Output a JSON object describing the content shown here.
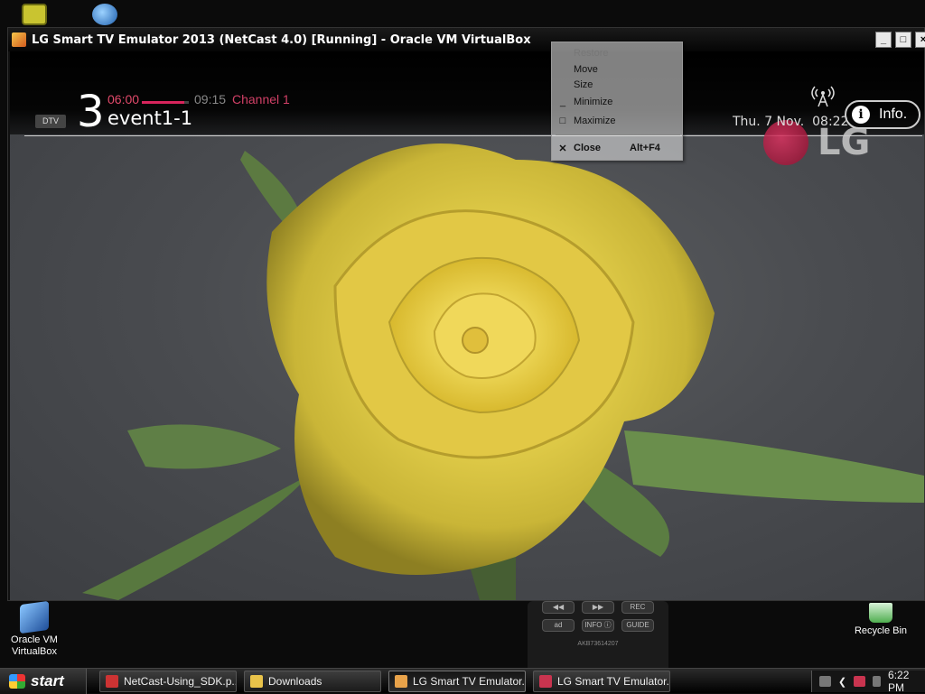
{
  "window": {
    "title": "LG Smart TV Emulator 2013 (NetCast 4.0) [Running] - Oracle VM VirtualBox",
    "minimize_label": "_",
    "maximize_label": "□",
    "close_label": "×"
  },
  "tv": {
    "badge": "DTV",
    "channel_number": "3",
    "start_time": "06:00",
    "end_time": "09:15",
    "channel_name": "Channel 1",
    "event_name": "event1-1",
    "progress": 0.9,
    "date": "Thu. 7 Nov.  08:22",
    "info_label": "Info.",
    "info_glyph": "i",
    "logo_text": "LG"
  },
  "context_menu": {
    "items": [
      {
        "label": "Restore",
        "marker": "",
        "accel": "",
        "enabled": false
      },
      {
        "label": "Move",
        "marker": "",
        "accel": "",
        "enabled": true
      },
      {
        "label": "Size",
        "marker": "",
        "accel": "",
        "enabled": true
      },
      {
        "label": "Minimize",
        "marker": "_",
        "accel": "",
        "enabled": true
      },
      {
        "label": "Maximize",
        "marker": "□",
        "accel": "",
        "enabled": true
      },
      {
        "label": "Close",
        "marker": "✕",
        "accel": "Alt+F4",
        "enabled": true
      }
    ]
  },
  "desktop": {
    "icons": [
      {
        "label": "Oracle VM\nVirtualBox"
      },
      {
        "label": "Recycle Bin"
      }
    ]
  },
  "remote": {
    "buttons": [
      "◀◀",
      "▶▶",
      "REC",
      "ad",
      "INFO ⓘ",
      "GUIDE"
    ],
    "model": "AKB73614207"
  },
  "taskbar": {
    "start_label": "start",
    "tasks": [
      {
        "label": "NetCast-Using_SDK.p...",
        "color": "#c33"
      },
      {
        "label": "Downloads",
        "color": "#e9c34a"
      },
      {
        "label": "LG Smart TV Emulator...",
        "color": "#e9a34a"
      },
      {
        "label": "LG Smart TV Emulator...",
        "color": "#c9344f"
      }
    ],
    "clock": "6:22 PM"
  }
}
